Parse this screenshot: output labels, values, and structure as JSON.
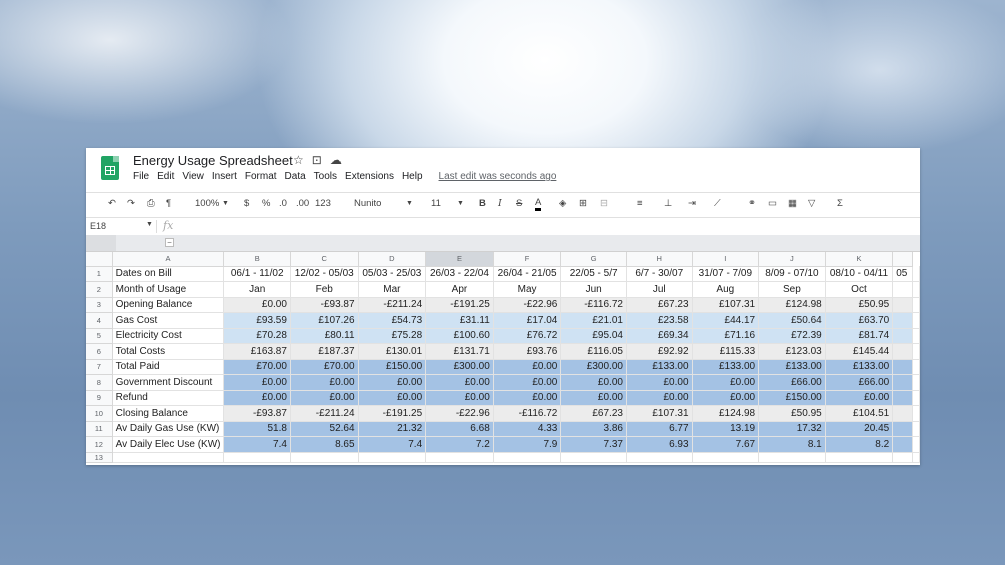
{
  "app": {
    "title": "Energy Usage Spreadsheet",
    "menu": [
      "File",
      "Edit",
      "View",
      "Insert",
      "Format",
      "Data",
      "Tools",
      "Extensions",
      "Help"
    ],
    "last_edit": "Last edit was seconds ago"
  },
  "toolbar": {
    "zoom": "100%",
    "currency": "$",
    "percent": "%",
    "dec_decrease": ".0",
    "dec_increase": ".00",
    "format_more": "123",
    "font": "Nunito",
    "font_size": "11",
    "bold": "B",
    "italic": "I",
    "strike": "S",
    "text_color": "A",
    "sum": "Σ"
  },
  "formula_bar": {
    "name_box": "E18",
    "fx": "fx",
    "value": ""
  },
  "grouping": {
    "button": "−"
  },
  "columns": [
    "A",
    "B",
    "C",
    "D",
    "E",
    "F",
    "G",
    "H",
    "I",
    "J",
    "K"
  ],
  "rows": [
    {
      "num": "1",
      "label": "Dates on Bill",
      "values": [
        "06/1 - 11/02",
        "12/02 - 05/03",
        "05/03 - 25/03",
        "26/03 - 22/04",
        "26/04 - 21/05",
        "22/05 - 5/7",
        "6/7 - 30/07",
        "31/07 - 7/09",
        "8/09 - 07/10",
        "08/10 - 04/11",
        "05"
      ]
    },
    {
      "num": "2",
      "label": "Month of Usage",
      "values": [
        "Jan",
        "Feb",
        "Mar",
        "Apr",
        "May",
        "Jun",
        "Jul",
        "Aug",
        "Sep",
        "Oct",
        ""
      ]
    },
    {
      "num": "3",
      "label": "Opening Balance",
      "values": [
        "£0.00",
        "-£93.87",
        "-£211.24",
        "-£191.25",
        "-£22.96",
        "-£116.72",
        "£67.23",
        "£107.31",
        "£124.98",
        "£50.95",
        ""
      ]
    },
    {
      "num": "4",
      "label": "Gas Cost",
      "values": [
        "£93.59",
        "£107.26",
        "£54.73",
        "£31.11",
        "£17.04",
        "£21.01",
        "£23.58",
        "£44.17",
        "£50.64",
        "£63.70",
        ""
      ]
    },
    {
      "num": "5",
      "label": "Electricity Cost",
      "values": [
        "£70.28",
        "£80.11",
        "£75.28",
        "£100.60",
        "£76.72",
        "£95.04",
        "£69.34",
        "£71.16",
        "£72.39",
        "£81.74",
        ""
      ]
    },
    {
      "num": "6",
      "label": "Total Costs",
      "values": [
        "£163.87",
        "£187.37",
        "£130.01",
        "£131.71",
        "£93.76",
        "£116.05",
        "£92.92",
        "£115.33",
        "£123.03",
        "£145.44",
        ""
      ]
    },
    {
      "num": "7",
      "label": "Total Paid",
      "values": [
        "£70.00",
        "£70.00",
        "£150.00",
        "£300.00",
        "£0.00",
        "£300.00",
        "£133.00",
        "£133.00",
        "£133.00",
        "£133.00",
        ""
      ]
    },
    {
      "num": "8",
      "label": "Government Discount",
      "values": [
        "£0.00",
        "£0.00",
        "£0.00",
        "£0.00",
        "£0.00",
        "£0.00",
        "£0.00",
        "£0.00",
        "£66.00",
        "£66.00",
        ""
      ]
    },
    {
      "num": "9",
      "label": "Refund",
      "values": [
        "£0.00",
        "£0.00",
        "£0.00",
        "£0.00",
        "£0.00",
        "£0.00",
        "£0.00",
        "£0.00",
        "£150.00",
        "£0.00",
        ""
      ]
    },
    {
      "num": "10",
      "label": "Closing Balance",
      "values": [
        "-£93.87",
        "-£211.24",
        "-£191.25",
        "-£22.96",
        "-£116.72",
        "£67.23",
        "£107.31",
        "£124.98",
        "£50.95",
        "£104.51",
        ""
      ]
    },
    {
      "num": "11",
      "label": "Av Daily Gas Use (KW)",
      "values": [
        "51.8",
        "52.64",
        "21.32",
        "6.68",
        "4.33",
        "3.86",
        "6.77",
        "13.19",
        "17.32",
        "20.45",
        ""
      ]
    },
    {
      "num": "12",
      "label": "Av Daily Elec Use (KW)",
      "values": [
        "7.4",
        "8.65",
        "7.4",
        "7.2",
        "7.9",
        "7.37",
        "6.93",
        "7.67",
        "8.1",
        "8.2",
        ""
      ]
    },
    {
      "num": "13",
      "label": "",
      "values": [
        "",
        "",
        "",
        "",
        "",
        "",
        "",
        "",
        "",
        "",
        ""
      ]
    }
  ],
  "row_styles": [
    "hdr",
    "hdr",
    "g",
    "lb",
    "lb",
    "g",
    "b",
    "b",
    "b",
    "g",
    "b",
    "b",
    "last"
  ]
}
